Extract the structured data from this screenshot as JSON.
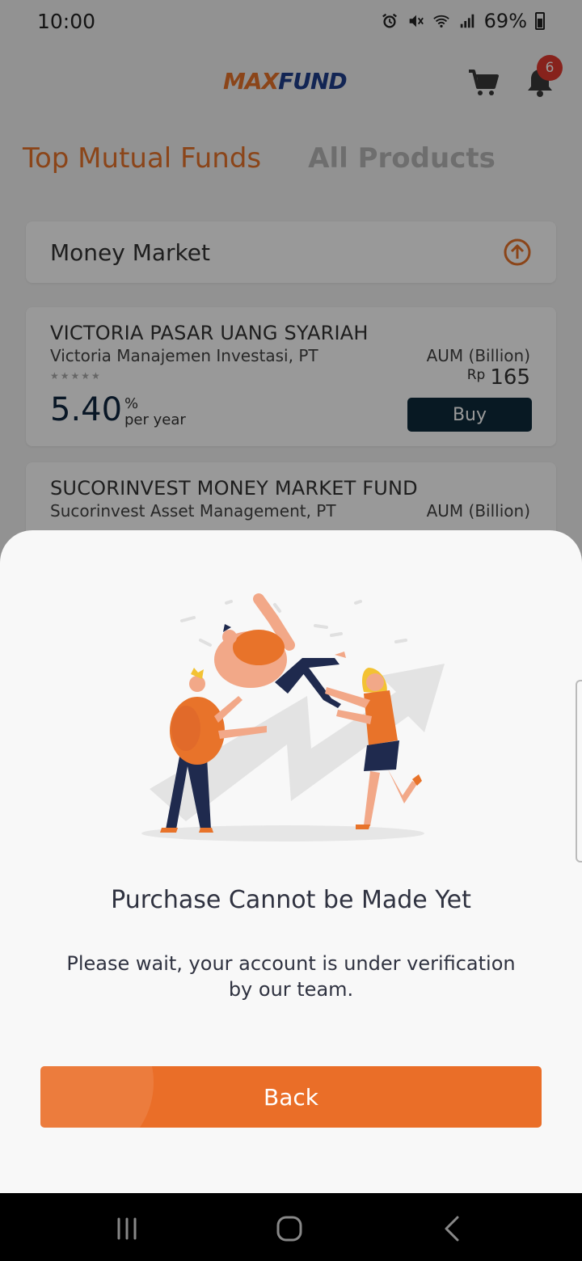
{
  "status_bar": {
    "time": "10:00",
    "battery": "69%",
    "icons": [
      "alarm-icon",
      "mute-icon",
      "wifi-icon",
      "signal-icon",
      "battery-icon"
    ]
  },
  "app_bar": {
    "logo_part1": "MAX",
    "logo_part2": "FUND",
    "notification_count": "6"
  },
  "tabs": [
    {
      "label": "Top Mutual Funds",
      "active": true
    },
    {
      "label": "All Products",
      "active": false
    }
  ],
  "category": {
    "label": "Money Market"
  },
  "funds": [
    {
      "name": "VICTORIA PASAR UANG SYARIAH",
      "manager": "Victoria Manajemen Investasi, PT",
      "stars": "★★★★★",
      "aum_label": "AUM (Billion)",
      "aum_currency": "Rp",
      "aum_value": "165",
      "return_value": "5.40",
      "return_unit": "%",
      "return_period": "per year",
      "buy_label": "Buy"
    },
    {
      "name": "SUCORINVEST MONEY MARKET FUND",
      "manager": "Sucorinvest Asset Management, PT",
      "aum_label": "AUM (Billion)"
    }
  ],
  "dialog": {
    "title": "Purchase Cannot be Made Yet",
    "message": "Please wait, your account is under verification by our team.",
    "button_label": "Back"
  },
  "colors": {
    "accent": "#ea6e28",
    "brand_blue": "#1f3e8c",
    "buy_button": "#0e2b3b",
    "badge": "#e23a2f"
  }
}
